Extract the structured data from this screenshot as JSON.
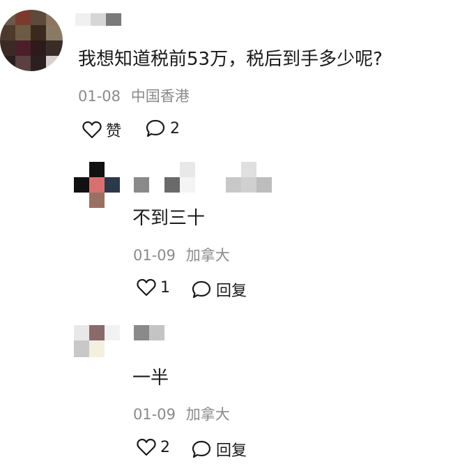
{
  "comments": [
    {
      "text": "我想知道税前53万，税后到手多少呢?",
      "date": "01-08",
      "location": "中国香港",
      "like_label": "赞",
      "reply_count": "2"
    },
    {
      "text": "不到三十",
      "date": "01-09",
      "location": "加拿大",
      "like_count": "1",
      "reply_label": "回复"
    },
    {
      "text": "一半",
      "date": "01-09",
      "location": "加拿大",
      "like_count": "2",
      "reply_label": "回复"
    }
  ],
  "icons": {
    "like": "heart-outline-icon",
    "comment": "speech-bubble-icon"
  }
}
